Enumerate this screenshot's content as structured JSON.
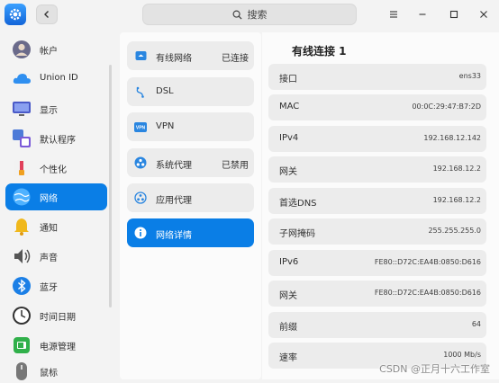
{
  "search": {
    "label": "搜索"
  },
  "sidebar": {
    "items": [
      {
        "label": "帐户",
        "icon": "account-avatar-icon",
        "color": "#6a6a8a"
      },
      {
        "label": "Union ID",
        "icon": "cloud-icon",
        "color": "#2f8ff0"
      },
      {
        "label": "显示",
        "icon": "monitor-icon",
        "color": "#5a6bd6"
      },
      {
        "label": "默认程序",
        "icon": "default-apps-icon",
        "color": "#4d7bd8"
      },
      {
        "label": "个性化",
        "icon": "personalization-icon",
        "color": "#e0405a"
      },
      {
        "label": "网络",
        "icon": "globe-network-icon",
        "color": "#ffffff",
        "active": true
      },
      {
        "label": "通知",
        "icon": "bell-icon",
        "color": "#f0b81c"
      },
      {
        "label": "声音",
        "icon": "speaker-icon",
        "color": "#555555"
      },
      {
        "label": "蓝牙",
        "icon": "bluetooth-icon",
        "color": "#1b7fe6"
      },
      {
        "label": "时间日期",
        "icon": "clock-icon",
        "color": "#333333"
      },
      {
        "label": "电源管理",
        "icon": "battery-icon",
        "color": "#30b04a"
      },
      {
        "label": "鼠标",
        "icon": "mouse-icon",
        "color": "#666666"
      }
    ]
  },
  "network": {
    "items": [
      {
        "label": "有线网络",
        "status": "已连接",
        "icon": "wired-network-icon"
      },
      {
        "label": "DSL",
        "status": "",
        "icon": "dsl-icon"
      },
      {
        "label": "VPN",
        "status": "",
        "icon": "vpn-icon"
      },
      {
        "label": "系统代理",
        "status": "已禁用",
        "icon": "system-proxy-icon"
      },
      {
        "label": "应用代理",
        "status": "",
        "icon": "app-proxy-icon"
      },
      {
        "label": "网络详情",
        "status": "",
        "icon": "info-icon",
        "active": true
      }
    ]
  },
  "detail": {
    "title": "有线连接 1",
    "rows": [
      {
        "key": "接口",
        "value": "ens33"
      },
      {
        "key": "MAC",
        "value": "00:0C:29:47:B7:2D"
      },
      {
        "key": "IPv4",
        "value": "192.168.12.142"
      },
      {
        "key": "网关",
        "value": "192.168.12.2"
      },
      {
        "key": "首选DNS",
        "value": "192.168.12.2"
      },
      {
        "key": "子网掩码",
        "value": "255.255.255.0"
      },
      {
        "key": "IPv6",
        "value": "FE80::D72C:EA4B:0850:D616"
      },
      {
        "key": "网关",
        "value": "FE80::D72C:EA4B:0850:D616"
      },
      {
        "key": "前缀",
        "value": "64"
      },
      {
        "key": "速率",
        "value": "1000 Mb/s"
      }
    ]
  },
  "watermark": "CSDN @正月十六工作室",
  "colors": {
    "accent": "#0a7ee6"
  }
}
